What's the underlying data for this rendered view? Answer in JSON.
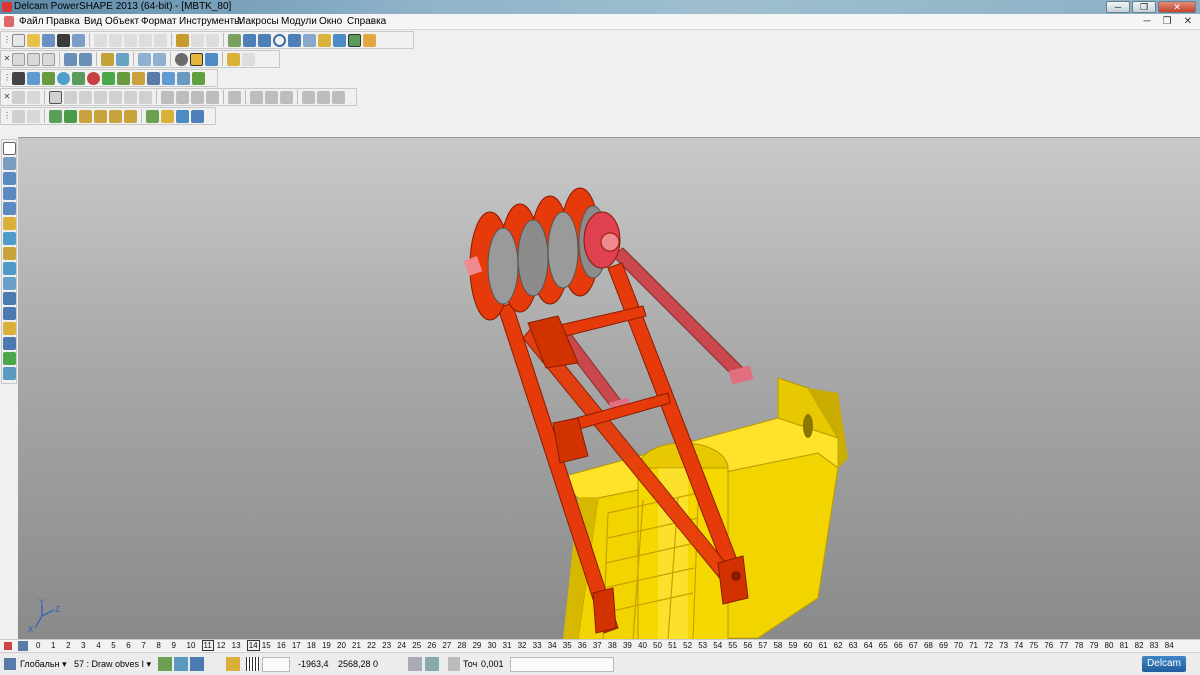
{
  "window": {
    "title": "Delcam PowerSHAPE 2013 (64-bit) - [MBTK_80]",
    "minimize": "─",
    "restore": "❐",
    "close": "✕"
  },
  "menu": {
    "items": [
      "Файл",
      "Правка",
      "Вид",
      "Объект",
      "Формат",
      "Инструменты",
      "Макросы",
      "Модули",
      "Окно",
      "Справка"
    ],
    "doc_buttons": [
      "─",
      "❐",
      "✕"
    ]
  },
  "ruler": {
    "numbers": [
      "0",
      "1",
      "2",
      "3",
      "4",
      "5",
      "6",
      "7",
      "8",
      "9",
      "10",
      "11",
      "12",
      "13",
      "14",
      "15",
      "16",
      "17",
      "18",
      "19",
      "20",
      "21",
      "22",
      "23",
      "24",
      "25",
      "26",
      "27",
      "28",
      "29",
      "30",
      "31",
      "32",
      "33",
      "34",
      "35",
      "36",
      "37",
      "38",
      "39",
      "40",
      "50",
      "51",
      "52",
      "53",
      "54",
      "55",
      "56",
      "57",
      "58",
      "59",
      "60",
      "61",
      "62",
      "63",
      "64",
      "65",
      "66",
      "67",
      "68",
      "69",
      "70",
      "71",
      "72",
      "73",
      "74",
      "75",
      "76",
      "77",
      "78",
      "79",
      "80",
      "81",
      "82",
      "83",
      "84"
    ],
    "boxed": [
      "11",
      "14"
    ]
  },
  "status": {
    "workplane": "Глобальн",
    "level": "57 : Draw obves I",
    "x": "-1963,4",
    "y": "2568,28",
    "z": "0",
    "tolerance_label": "Точ",
    "tolerance_value": "0,001",
    "brand": "Delcam"
  },
  "axis": {
    "y": "Y",
    "z": "Z",
    "x": "X"
  },
  "colors": {
    "crane_yellow": "#f2d400",
    "boom_red": "#e63a0a",
    "sheave_gray": "#9a9a9a",
    "brace_pink": "#c8484e"
  },
  "icons": [
    "new-icon",
    "open-icon",
    "save-icon",
    "print-icon",
    "cut-icon",
    "copy-icon",
    "paste-icon",
    "undo-icon",
    "redo-icon",
    "select-icon",
    "zoom-icon",
    "rotate-icon",
    "shade-icon",
    "wireframe-icon",
    "surface-icon",
    "solid-icon",
    "line-icon",
    "arc-icon",
    "curve-icon"
  ]
}
